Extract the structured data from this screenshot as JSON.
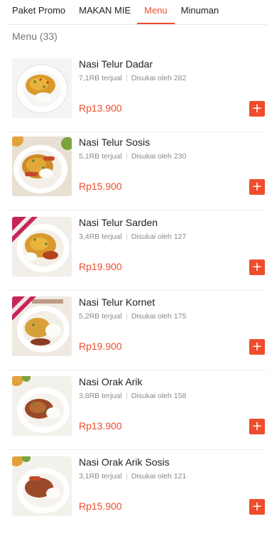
{
  "tabs": [
    {
      "label": "Paket Promo",
      "active": false
    },
    {
      "label": "MAKAN MIE",
      "active": false
    },
    {
      "label": "Menu",
      "active": true
    },
    {
      "label": "Minuman",
      "active": false
    }
  ],
  "section": {
    "title": "Menu (33)"
  },
  "colors": {
    "accent": "#ee4d2d"
  },
  "add_icon": "plus-icon",
  "items": [
    {
      "name": "Nasi Telur Dadar",
      "sold": "7,1RB terjual",
      "likes": "Disukai oleh 282",
      "price": "Rp13.900",
      "add": "+"
    },
    {
      "name": "Nasi Telur Sosis",
      "sold": "5,1RB terjual",
      "likes": "Disukai oleh 230",
      "price": "Rp15.900",
      "add": "+"
    },
    {
      "name": "Nasi Telur Sarden",
      "sold": "3,4RB terjual",
      "likes": "Disukai oleh 127",
      "price": "Rp19.900",
      "add": "+"
    },
    {
      "name": "Nasi Telur Kornet",
      "sold": "5,2RB terjual",
      "likes": "Disukai oleh 175",
      "price": "Rp19.900",
      "add": "+"
    },
    {
      "name": "Nasi Orak Arik",
      "sold": "3,8RB terjual",
      "likes": "Disukai oleh 158",
      "price": "Rp13.900",
      "add": "+"
    },
    {
      "name": "Nasi Orak Arik Sosis",
      "sold": "3,1RB terjual",
      "likes": "Disukai oleh 121",
      "price": "Rp15.900",
      "add": "+"
    }
  ]
}
